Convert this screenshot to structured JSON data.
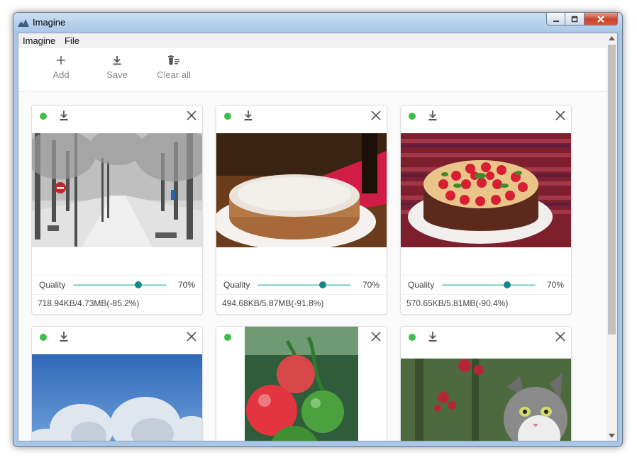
{
  "window": {
    "title": "Imagine",
    "controls": {
      "minimize": "minimize",
      "maximize": "maximize",
      "close": "close"
    }
  },
  "menu": {
    "items": [
      "Imagine",
      "File"
    ]
  },
  "toolbar": {
    "add_label": "Add",
    "save_label": "Save",
    "clear_label": "Clear all"
  },
  "colors": {
    "status_dot": "#3fbf4a",
    "slider_track": "#a6dbd8",
    "slider_knob": "#16888a"
  },
  "cards": [
    {
      "subject": "snowy avenue",
      "quality_label": "Quality",
      "quality_value": 70,
      "quality_text": "70%",
      "size_text": "718.94KB/4.73MB(-85.2%)"
    },
    {
      "subject": "cheesecake",
      "quality_label": "Quality",
      "quality_value": 70,
      "quality_text": "70%",
      "size_text": "494.68KB/5.87MB(-91.8%)"
    },
    {
      "subject": "strawberry cake",
      "quality_label": "Quality",
      "quality_value": 70,
      "quality_text": "70%",
      "size_text": "570.65KB/5.81MB(-90.4%)"
    },
    {
      "subject": "frosted trees"
    },
    {
      "subject": "tomatoes"
    },
    {
      "subject": "cat"
    }
  ]
}
